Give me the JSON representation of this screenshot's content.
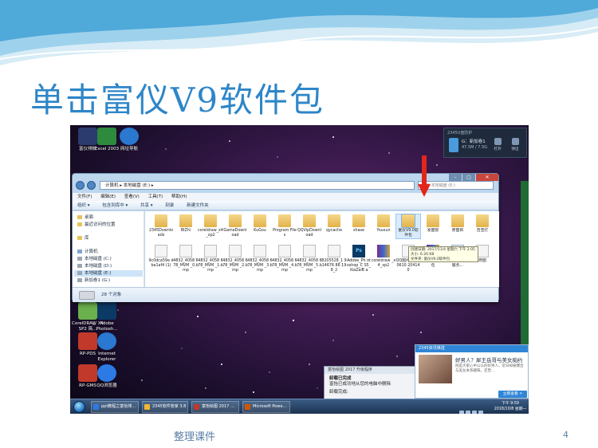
{
  "slide": {
    "title": "单击富仪V9软件包",
    "footer": "整理课件",
    "page_number": "4"
  },
  "desktop_icons": [
    {
      "label": "富仪排板",
      "color": "#2b3b6e"
    },
    {
      "label": "Excel 2003",
      "color": "#2e8a3c"
    },
    {
      "label": "网址导航",
      "color": "#2a78d0"
    },
    {
      "label": "CorelDRAW X4 SP2 简...",
      "color": "#6ab04c"
    },
    {
      "label": "Adobe Photosh...",
      "color": "#0b3a66"
    },
    {
      "label": "RP-PDS",
      "color": "#c0392b"
    },
    {
      "label": "Internet Explorer",
      "color": "#2a78d0"
    },
    {
      "label": "RP-GMS",
      "color": "#c0392b"
    },
    {
      "label": "QQ浏览器",
      "color": "#2c7be5"
    }
  ],
  "usb_popup": {
    "header": "2345U盘防护",
    "drive_name": "G：新加卷1",
    "drive_size": "47.5M / 7.5G",
    "actions": [
      "打开",
      "弹出"
    ]
  },
  "explorer": {
    "address": "计算机 ▸ 本地磁盘 (E:) ▸",
    "search_placeholder": "搜索 本地磁盘 (E:)",
    "menu": [
      "文件(F)",
      "编辑(E)",
      "查看(V)",
      "工具(T)",
      "帮助(H)"
    ],
    "toolbar": [
      "组织 ▾",
      "包含到库中 ▾",
      "共享 ▾",
      "刻录",
      "新建文件夹"
    ],
    "nav": [
      {
        "label": "桌面",
        "selected": false
      },
      {
        "label": "最近访问的位置",
        "selected": false
      },
      {
        "label": "库",
        "selected": false
      },
      {
        "label": "计算机",
        "selected": false
      },
      {
        "label": "本地磁盘 (C:)",
        "selected": false
      },
      {
        "label": "本地磁盘 (D:)",
        "selected": false
      },
      {
        "label": "本地磁盘 (E:)",
        "selected": true
      },
      {
        "label": "新加卷1 (G:)",
        "selected": false
      }
    ],
    "files_row1": [
      {
        "label": "2345Downloads",
        "kind": "folder"
      },
      {
        "label": "BIZhi",
        "kind": "folder"
      },
      {
        "label": "coreldraw_x4_xp2",
        "kind": "folder"
      },
      {
        "label": "GameDownload",
        "kind": "folder"
      },
      {
        "label": "KuGou",
        "kind": "folder"
      },
      {
        "label": "Program Files",
        "kind": "folder"
      },
      {
        "label": "QQVipDownload",
        "kind": "folder"
      },
      {
        "label": "qycache",
        "kind": "folder"
      },
      {
        "label": "shase",
        "kind": "folder"
      },
      {
        "label": "Youxun",
        "kind": "folder"
      },
      {
        "label": "富仪V9.0软件包",
        "kind": "folder-selected"
      },
      {
        "label": "发图管",
        "kind": "folder"
      },
      {
        "label": "原图目",
        "kind": "folder"
      },
      {
        "label": "百宝打",
        "kind": "folder"
      }
    ],
    "files_row2": [
      {
        "label": "9c0dca59e dba1af4 (1)",
        "kind": "bmp"
      },
      {
        "label": "4832_4058 678_MVM _0.bmp",
        "kind": "bmp"
      },
      {
        "label": "4832_4058 678_MVM _1.bmp",
        "kind": "bmp"
      },
      {
        "label": "4832_4058 678_MVM _2.bmp",
        "kind": "bmp"
      },
      {
        "label": "4832_4058 678_MVM _3.bmp",
        "kind": "bmp"
      },
      {
        "label": "4832_4058 678_MVM _4.bmp",
        "kind": "bmp"
      },
      {
        "label": "4832_4058 678_MVM _5.bmp",
        "kind": "bmp"
      },
      {
        "label": "8205528_1 914676 86 198_2",
        "kind": "bmp"
      },
      {
        "label": "Adobe_Ph otoshop_C S5_XiaZaiB a",
        "kind": "ps"
      },
      {
        "label": "coreldraw _x4_xp2",
        "kind": "rar"
      },
      {
        "label": "QQ图片 20180610 204140",
        "kind": "bmp"
      },
      {
        "label": "富仪V9.0软 件包",
        "kind": "rar"
      },
      {
        "label": "单机版V9 打印服务...",
        "kind": "exe"
      },
      {
        "label": "原图",
        "kind": "bmp"
      }
    ],
    "tooltip": [
      "创建日期: 2017/11/4 星期六 下午 2:05",
      "大小: 6.26 KB",
      "文件夹: 富仪V9.0软件包"
    ],
    "status": "28 个对象"
  },
  "dialog_center": {
    "title": "富怡绘图 2017 升级程序",
    "line1": "卸载已完成",
    "line2": "富怡已成功地从您的电脑中删除",
    "line3": "卸载完成:"
  },
  "notify": {
    "header": "2345资讯推送",
    "headline": "好男人？犀王岳哥与美女痴约",
    "sub": "他是大家心中公认的好男人，近日却被爆出与美女关系暧昧，还曾...",
    "button": "立即查看 >"
  },
  "taskbar": {
    "items": [
      {
        "label": "ppt教程之富怡排...",
        "color": "#2c7be5"
      },
      {
        "label": "2345软件管家 3.8",
        "color": "#f2b632"
      },
      {
        "label": "富怡绘图 2017 ...",
        "color": "#c0392b"
      },
      {
        "label": "Microsoft Powe...",
        "color": "#d35400"
      }
    ],
    "time": "下午 9:59",
    "date": "2018/10/8 星期一"
  }
}
